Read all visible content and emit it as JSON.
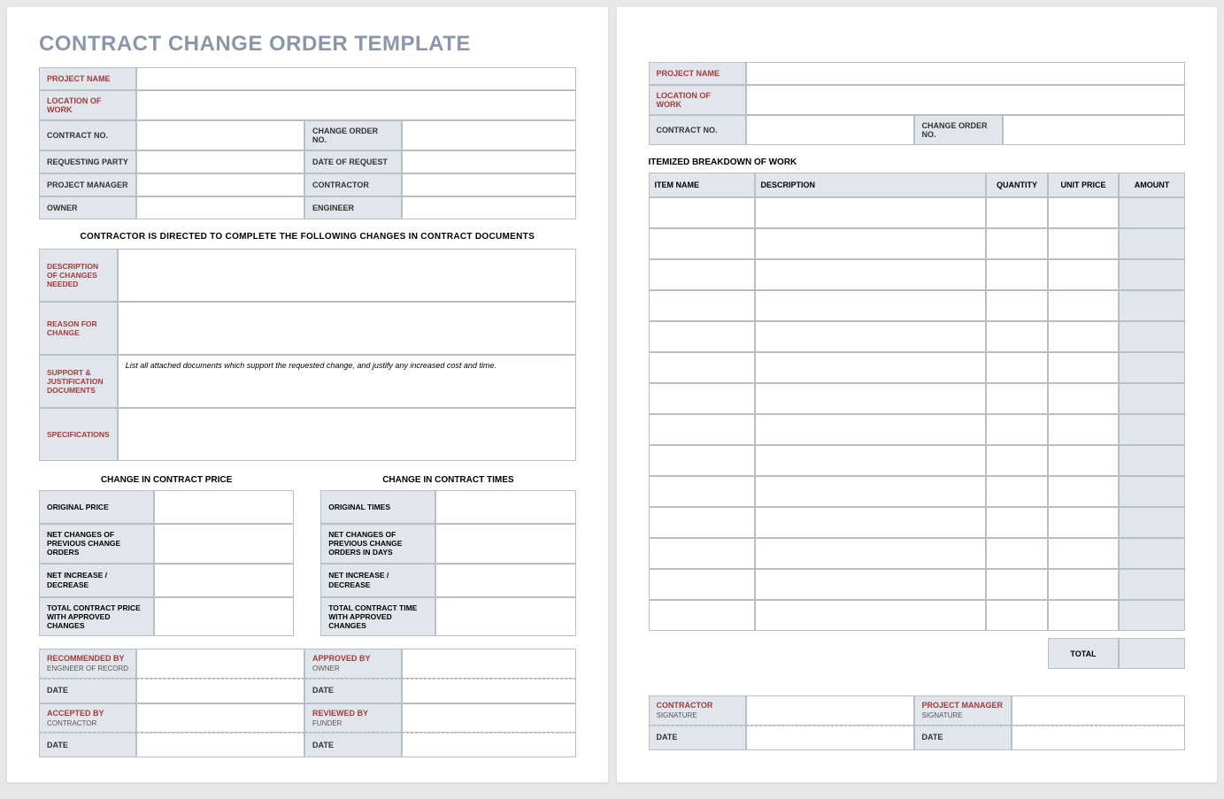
{
  "title": "CONTRACT CHANGE ORDER TEMPLATE",
  "info": {
    "project_name": "PROJECT NAME",
    "location": "LOCATION OF WORK",
    "contract_no": "CONTRACT NO.",
    "change_no": "CHANGE ORDER NO.",
    "requesting": "REQUESTING PARTY",
    "date_request": "DATE OF REQUEST",
    "pm": "PROJECT MANAGER",
    "contractor": "CONTRACTOR",
    "owner": "OWNER",
    "engineer": "ENGINEER"
  },
  "directive": "CONTRACTOR IS DIRECTED TO COMPLETE THE FOLLOWING CHANGES IN CONTRACT DOCUMENTS",
  "desc": {
    "changes": "DESCRIPTION OF CHANGES NEEDED",
    "reason": "REASON FOR CHANGE",
    "support": "SUPPORT & JUSTIFICATION DOCUMENTS",
    "support_hint": "List all attached documents which support the requested change, and justify any increased cost and time.",
    "specs": "SPECIFICATIONS"
  },
  "price": {
    "head": "CHANGE IN CONTRACT PRICE",
    "orig": "ORIGINAL PRICE",
    "net_prev": "NET CHANGES OF PREVIOUS CHANGE ORDERS",
    "net_inc": "NET INCREASE / DECREASE",
    "total": "TOTAL CONTRACT PRICE WITH APPROVED CHANGES"
  },
  "times": {
    "head": "CHANGE IN CONTRACT TIMES",
    "orig": "ORIGINAL TIMES",
    "net_prev": "NET CHANGES OF PREVIOUS CHANGE ORDERS IN DAYS",
    "net_inc": "NET INCREASE / DECREASE",
    "total": "TOTAL CONTRACT TIME WITH APPROVED CHANGES"
  },
  "sig": {
    "recommended": "RECOMMENDED BY",
    "recommended_sub": "ENGINEER OF RECORD",
    "approved": "APPROVED BY",
    "approved_sub": "OWNER",
    "accepted": "ACCEPTED BY",
    "accepted_sub": "CONTRACTOR",
    "reviewed": "REVIEWED BY",
    "reviewed_sub": "FUNDER",
    "date": "DATE"
  },
  "p2": {
    "section": "ITEMIZED BREAKDOWN OF WORK",
    "headers": {
      "item": "ITEM NAME",
      "desc": "DESCRIPTION",
      "qty": "QUANTITY",
      "price": "UNIT PRICE",
      "amount": "AMOUNT"
    },
    "total": "TOTAL",
    "sig": {
      "contractor": "CONTRACTOR",
      "pm": "PROJECT MANAGER",
      "signature": "SIGNATURE",
      "date": "DATE"
    }
  }
}
